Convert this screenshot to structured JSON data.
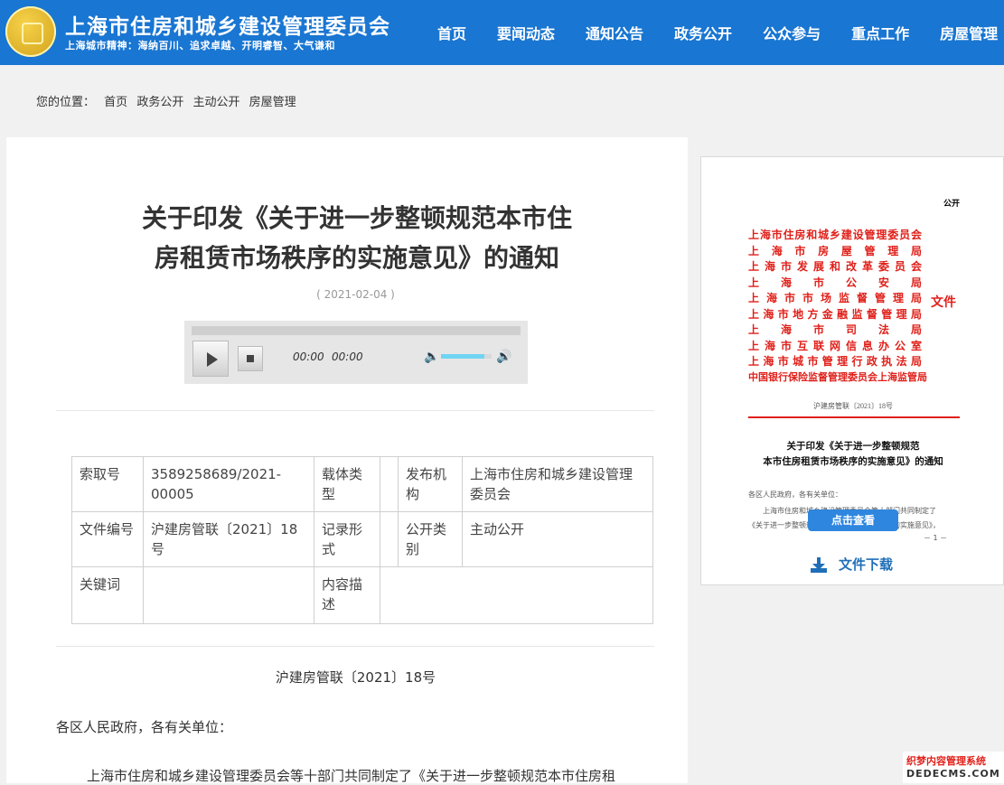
{
  "header": {
    "title": "上海市住房和城乡建设管理委员会",
    "slogan": "上海城市精神：海纳百川、追求卓越、开明睿智、大气谦和",
    "nav": [
      "首页",
      "要闻动态",
      "通知公告",
      "政务公开",
      "公众参与",
      "重点工作",
      "房屋管理"
    ]
  },
  "breadcrumb": {
    "label": "您的位置：",
    "items": [
      "首页",
      "政务公开",
      "主动公开",
      "房屋管理"
    ]
  },
  "article": {
    "title_line1": "关于印发《关于进一步整顿规范本市住",
    "title_line2": "房租赁市场秩序的实施意见》的通知",
    "date": "( 2021-02-04 )",
    "player": {
      "current": "00:00",
      "duration": "00:00",
      "volume": 0.85
    },
    "meta": {
      "suoquhao_label": "索取号",
      "suoquhao": "3589258689/2021-00005",
      "zaiti_label": "载体类型",
      "zaiti": "",
      "fabu_label": "发布机构",
      "fabu": "上海市住房和城乡建设管理委员会",
      "wenjian_label": "文件编号",
      "wenjian": "沪建房管联〔2021〕18号",
      "jilu_label": "记录形式",
      "jilu": "",
      "gongkai_label": "公开类别",
      "gongkai": "主动公开",
      "guanjianci_label": "关键词",
      "guanjianci": "",
      "neirong_label": "内容描述",
      "neirong": ""
    },
    "doc_no": "沪建房管联〔2021〕18号",
    "recipients": "各区人民政府，各有关单位：",
    "body_start": "上海市住房和城乡建设管理委员会等十部门共同制定了《关于进一步整顿规范本市住房租"
  },
  "document_preview": {
    "gongkai": "公开",
    "orgs": [
      "上海市住房和城乡建设管理委员会",
      "上海市房屋管理局",
      "上海市发展和改革委员会",
      "上海市公安局",
      "上海市市场监督管理局",
      "上海市地方金融监督管理局",
      "上海市司法局",
      "上海市互联网信息办公室",
      "上海市城市管理行政执法局",
      "中国银行保险监督管理委员会上海监管局"
    ],
    "wenjian": "文件",
    "doc_no": "沪建房管联〔2021〕18号",
    "title_line1": "关于印发《关于进一步整顿规范",
    "title_line2": "本市住房租赁市场秩序的实施意见》的通知",
    "line1": "各区人民政府，各有关单位：",
    "line2": "上海市住房和城乡建设管理委员会等十部门共同制定了",
    "line3": "《关于进一步整顿规范本市住房租赁市场秩序的实施意见》，",
    "page": "－ 1 －",
    "view_button": "点击查看",
    "download": "文件下载"
  },
  "watermark": {
    "line1": "织梦内容管理系统",
    "line2": "DEDECMS.COM"
  },
  "colors": {
    "header": "#1976d2",
    "red": "#e0201a",
    "link": "#1f6fb8"
  }
}
